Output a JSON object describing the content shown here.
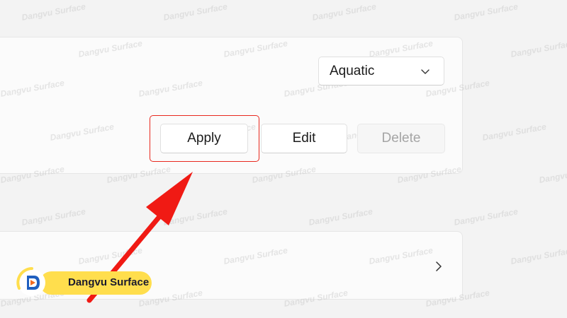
{
  "theme_dropdown": {
    "selected_value": "Aquatic",
    "icon": "chevron-down-icon"
  },
  "actions": {
    "apply_label": "Apply",
    "edit_label": "Edit",
    "delete_label": "Delete"
  },
  "row": {
    "icon": "chevron-right-icon"
  },
  "annotation": {
    "highlight_color": "#e8281e",
    "arrow_color": "#f01a14"
  },
  "watermark": {
    "brand_text": "Dangvu Surface",
    "logo_pill_color": "#ffde4d"
  },
  "colors": {
    "background": "#f3f3f3",
    "card": "#fbfbfb",
    "disabled_text": "#a5a5a5"
  }
}
